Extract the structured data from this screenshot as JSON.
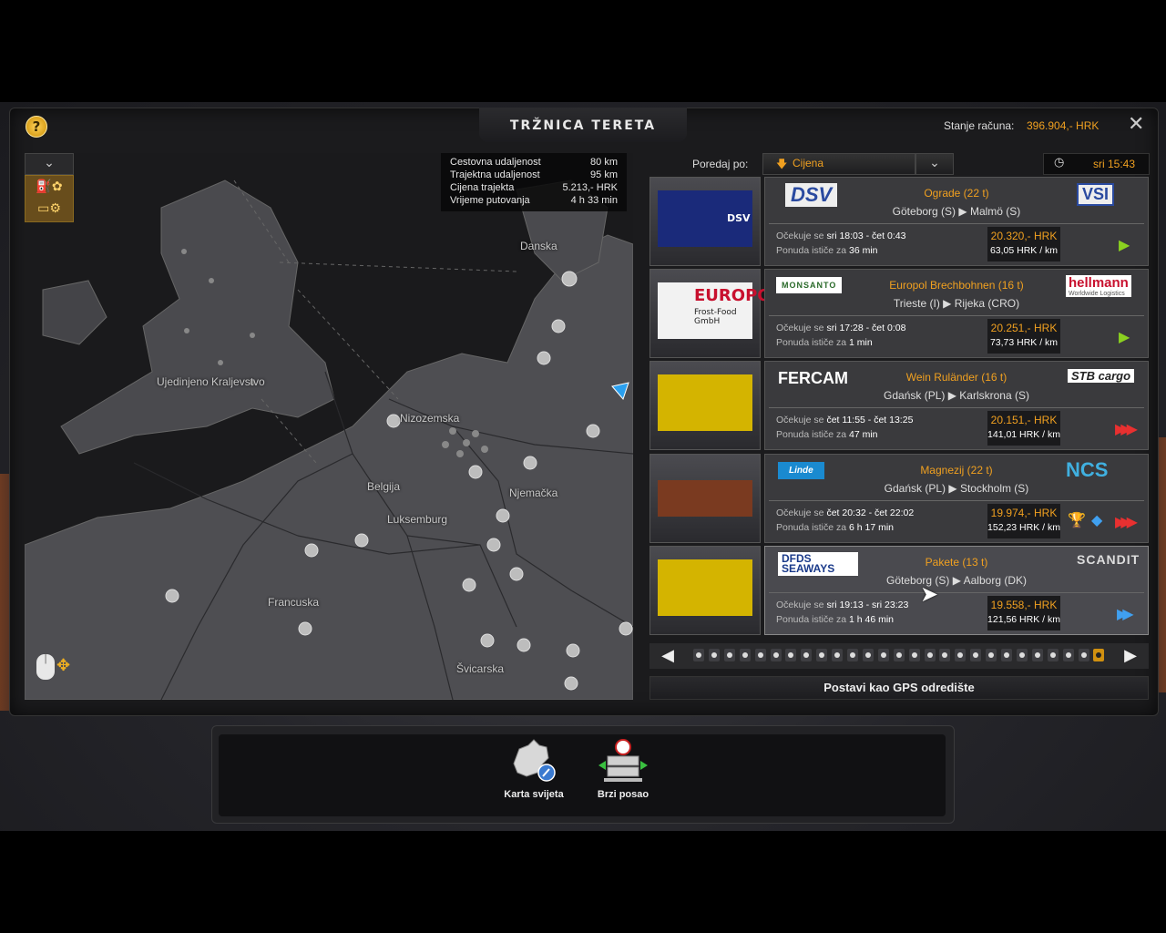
{
  "header": {
    "title": "TRŽNICA TERETA",
    "balance_label": "Stanje računa:",
    "balance_value": "396.904,- HRK",
    "help_icon": "?",
    "close_icon": "✕"
  },
  "map": {
    "labels": {
      "danska": "Danska",
      "uk": "Ujedinjeno Kraljevstvo",
      "nizozemska": "Nizozemska",
      "belgija": "Belgija",
      "luksemburg": "Luksemburg",
      "njemacka": "Njemačka",
      "francuska": "Francuska",
      "svicarska": "Švicarska"
    },
    "info": {
      "road_label": "Cestovna udaljenost",
      "road_value": "80 km",
      "ferry_label": "Trajektna udaljenost",
      "ferry_value": "95 km",
      "ferry_price_label": "Cijena trajekta",
      "ferry_price_value": "5.213,- HRK",
      "time_label": "Vrijeme putovanja",
      "time_value": "4 h 33 min"
    }
  },
  "sort": {
    "label": "Poredaj po:",
    "value": "Cijena"
  },
  "clock": {
    "time": "sri 15:43"
  },
  "jobs": [
    {
      "company": "DSV",
      "recipient": "VSI",
      "cargo": "Ograde (22 t)",
      "from": "Göteborg (S)",
      "to": "Malmö (S)",
      "expect_label": "Očekuje se",
      "expect_value": "sri 18:03 - čet 0:43",
      "offer_label": "Ponuda ističe za",
      "offer_value": "36 min",
      "price": "20.320,- HRK",
      "per_km": "63,05 HRK / km",
      "urgency": "▶"
    },
    {
      "company": "MONSANTO",
      "recipient": "hellmann",
      "recipient_sub": "Worldwide Logistics",
      "cargo": "Europol Brechbohnen (16 t)",
      "from": "Trieste (I)",
      "to": "Rijeka (CRO)",
      "expect_label": "Očekuje se",
      "expect_value": "sri 17:28 - čet 0:08",
      "offer_label": "Ponuda ističe za",
      "offer_value": "1 min",
      "price": "20.251,- HRK",
      "per_km": "73,73 HRK / km",
      "urgency": "▶",
      "trailer_text": "EUROPOL",
      "trailer_sub": "Frost-Food GmbH"
    },
    {
      "company": "FERCAM",
      "recipient": "STB cargo",
      "cargo": "Wein Ruländer  (16 t)",
      "from": "Gdańsk (PL)",
      "to": "Karlskrona (S)",
      "expect_label": "Očekuje se",
      "expect_value": "čet 11:55 - čet 13:25",
      "offer_label": "Ponuda ističe za",
      "offer_value": "47 min",
      "price": "20.151,- HRK",
      "per_km": "141,01 HRK / km",
      "urgency": "▶▶▶"
    },
    {
      "company": "Linde",
      "recipient": "NCS",
      "cargo": "Magnezij (22 t)",
      "from": "Gdańsk (PL)",
      "to": "Stockholm (S)",
      "expect_label": "Očekuje se",
      "expect_value": "čet 20:32 - čet 22:02",
      "offer_label": "Ponuda ističe za",
      "offer_value": "6 h 17 min",
      "price": "19.974,- HRK",
      "per_km": "152,23 HRK / km",
      "urgency": "▶▶▶"
    },
    {
      "company": "DFDS SEAWAYS",
      "recipient": "SCANDIT",
      "cargo": "Pakete (13 t)",
      "from": "Göteborg (S)",
      "to": "Aalborg (DK)",
      "expect_label": "Očekuje se",
      "expect_value": "sri 19:13 - sri 23:23",
      "offer_label": "Ponuda ističe za",
      "offer_value": "1 h 46 min",
      "price": "19.558,- HRK",
      "per_km": "121,56 HRK / km",
      "urgency": "▶▶"
    }
  ],
  "pager": {
    "prev": "◀",
    "next": "▶",
    "total": 27,
    "active": 27
  },
  "gps_button": "Postavi kao GPS odredište",
  "bottom": {
    "world_map": "Karta svijeta",
    "quick_job": "Brzi posao"
  },
  "colors": {
    "accent": "#f0a020",
    "green_arrow": "#8ad020",
    "red_arrow": "#e83030",
    "blue_arrow": "#40a0f0"
  }
}
